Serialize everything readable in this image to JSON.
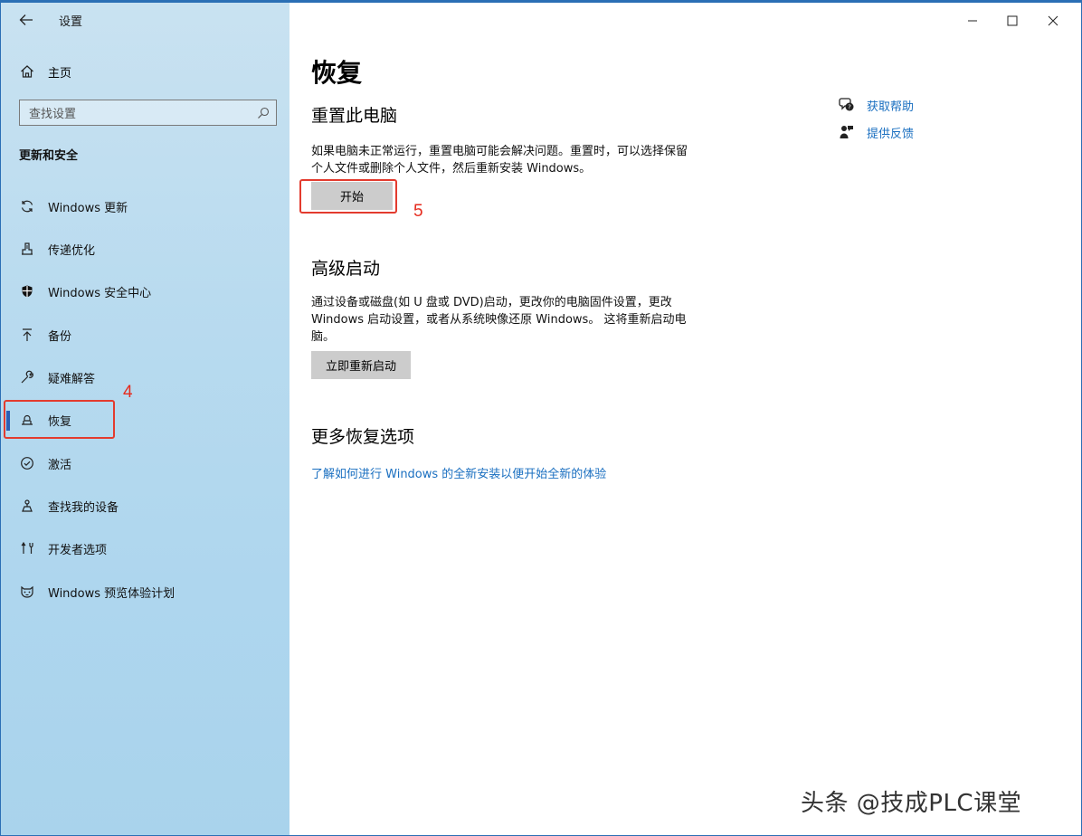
{
  "app": {
    "title": "设置"
  },
  "sidebar": {
    "home_label": "主页",
    "search_placeholder": "查找设置",
    "section_title": "更新和安全",
    "items": [
      {
        "label": "Windows 更新",
        "icon": "sync-icon"
      },
      {
        "label": "传递优化",
        "icon": "delivery-optimization-icon"
      },
      {
        "label": "Windows 安全中心",
        "icon": "shield-icon"
      },
      {
        "label": "备份",
        "icon": "backup-arrow-icon"
      },
      {
        "label": "疑难解答",
        "icon": "wrench-icon"
      },
      {
        "label": "恢复",
        "icon": "recovery-icon",
        "active": true
      },
      {
        "label": "激活",
        "icon": "check-circle-icon"
      },
      {
        "label": "查找我的设备",
        "icon": "find-device-icon"
      },
      {
        "label": "开发者选项",
        "icon": "developer-tools-icon"
      },
      {
        "label": "Windows 预览体验计划",
        "icon": "insider-cat-icon"
      }
    ]
  },
  "main": {
    "title": "恢复",
    "reset": {
      "heading": "重置此电脑",
      "description_line1": "如果电脑未正常运行，重置电脑可能会解决问题。重置时，可以选择保留",
      "description_line2": "个人文件或删除个人文件，然后重新安装 Windows。",
      "button_label": "开始"
    },
    "advanced": {
      "heading": "高级启动",
      "description_line1": "通过设备或磁盘(如 U 盘或 DVD)启动，更改你的电脑固件设置，更改",
      "description_line2": "Windows 启动设置，或者从系统映像还原 Windows。 这将重新启动电",
      "description_line3": "脑。",
      "button_label": "立即重新启动"
    },
    "more": {
      "heading": "更多恢复选项",
      "link_label": "了解如何进行 Windows 的全新安装以便开始全新的体验"
    }
  },
  "help_links": {
    "get_help": "获取帮助",
    "feedback": "提供反馈"
  },
  "annotations": {
    "step4": "4",
    "step5": "5",
    "watermark": "头条 @技成PLC课堂"
  },
  "colors": {
    "accent": "#2b5fb5",
    "link": "#1a6fc0",
    "annotation_red": "#e33b2e",
    "button_gray": "#cccccc"
  }
}
